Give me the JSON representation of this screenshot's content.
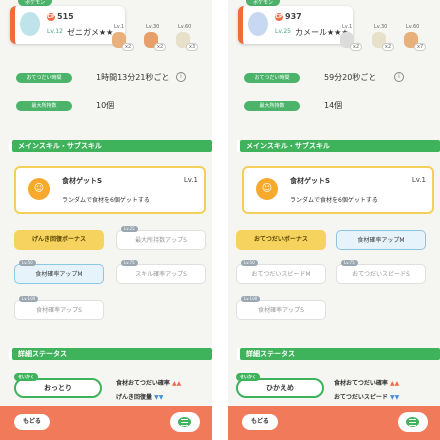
{
  "left": {
    "top_tag": "ポケモン",
    "header": {
      "cp_icon": "CP",
      "cp": "515",
      "level": "Lv.12",
      "name": "ゼニガメ★★"
    },
    "ingredients": [
      {
        "level": "Lv.1",
        "count": "x2",
        "color": "#e8b07a"
      },
      {
        "level": "Lv.30",
        "count": "x2",
        "color": "#e8a06a"
      },
      {
        "level": "Lv.60",
        "count": "x3",
        "color": "#e6e1c8"
      }
    ],
    "info": [
      {
        "label": "おてつだい時間",
        "value": "1時間13分21秒ごと",
        "hint": "i"
      },
      {
        "label": "最大所持数",
        "value": "10個"
      }
    ],
    "section_skills": "メインスキル・サブスキル",
    "main_skill": {
      "icon": "☺",
      "name": "食材ゲットS",
      "level": "Lv.1",
      "desc": "ランダムで食材を6個ゲットする"
    },
    "subskills": [
      {
        "label": "げんき回復ボーナス",
        "tag": "",
        "state": "main"
      },
      {
        "label": "最大所持数アップS",
        "tag": "Lv.25",
        "state": "inactive"
      },
      {
        "label": "食材確率アップM",
        "tag": "Lv.50",
        "state": "active"
      },
      {
        "label": "スキル確率アップS",
        "tag": "Lv.75",
        "state": "inactive"
      },
      {
        "label": "食材確率アップS",
        "tag": "Lv.100",
        "state": "inactive"
      }
    ],
    "section_status": "詳細ステータス",
    "nature": {
      "tag": "せいかく",
      "name": "おっとり"
    },
    "effects": [
      {
        "label": "食材おてつだい確率",
        "arrows": "▲▲",
        "dir": "up"
      },
      {
        "label": "げんき回復量",
        "arrows": "▼▼",
        "dir": "down"
      }
    ],
    "footer": {
      "back": "もどる"
    }
  },
  "right": {
    "top_tag": "ポケモン",
    "header": {
      "cp_icon": "CP",
      "cp": "937",
      "level": "Lv.25",
      "name": "カメール★★★"
    },
    "ingredients": [
      {
        "level": "Lv.1",
        "count": "x2",
        "color": "#dcdcdc"
      },
      {
        "level": "Lv.30",
        "count": "x2",
        "color": "#e6e1c8"
      },
      {
        "level": "Lv.60",
        "count": "x7",
        "color": "#e8b07a"
      }
    ],
    "info": [
      {
        "label": "おてつだい時間",
        "value": "59分20秒ごと",
        "hint": "i"
      },
      {
        "label": "最大所持数",
        "value": "14個"
      }
    ],
    "section_skills": "メインスキル・サブスキル",
    "main_skill": {
      "icon": "☺",
      "name": "食材ゲットS",
      "level": "Lv.1",
      "desc": "ランダムで食材を6個ゲットする"
    },
    "subskills": [
      {
        "label": "おてつだいボーナス",
        "tag": "",
        "state": "main"
      },
      {
        "label": "食材確率アップM",
        "tag": "",
        "state": "active"
      },
      {
        "label": "おてつだいスピードM",
        "tag": "Lv.50",
        "state": "inactive"
      },
      {
        "label": "おてつだいスピードS",
        "tag": "Lv.75",
        "state": "inactive"
      },
      {
        "label": "食材確率アップS",
        "tag": "Lv.100",
        "state": "inactive"
      }
    ],
    "section_status": "詳細ステータス",
    "nature": {
      "tag": "せいかく",
      "name": "ひかえめ"
    },
    "effects": [
      {
        "label": "食材おてつだい確率",
        "arrows": "▲▲",
        "dir": "up"
      },
      {
        "label": "おてつだいスピード",
        "arrows": "▼▼",
        "dir": "down"
      }
    ],
    "footer": {
      "back": "もどる"
    }
  }
}
